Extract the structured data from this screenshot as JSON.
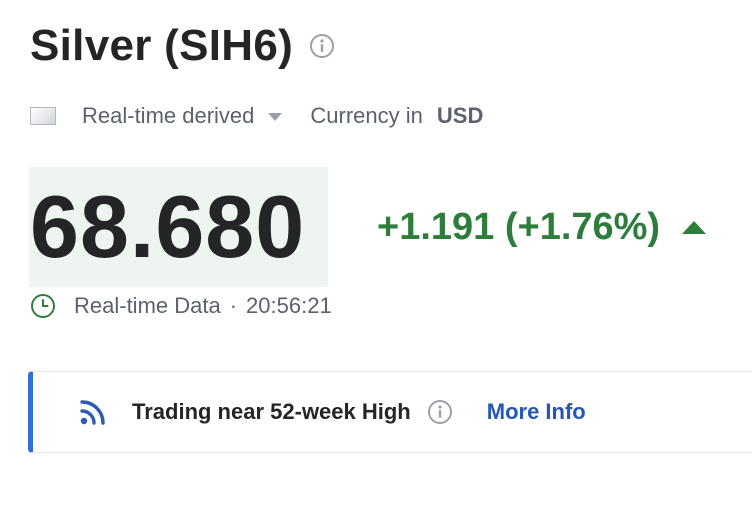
{
  "header": {
    "title": "Silver (SIH6)",
    "info_icon": "info-circle-icon"
  },
  "meta": {
    "flag_icon": "flag-icon",
    "data_type": "Real-time derived",
    "currency_label": "Currency in",
    "currency_code": "USD"
  },
  "quote": {
    "price": "68.680",
    "change": "+1.191 (+1.76%)",
    "direction": "up",
    "positive_color": "#2f7d3d",
    "highlight_color": "#eef5f0"
  },
  "status": {
    "clock_icon": "clock-icon",
    "label": "Real-time Data",
    "separator": "·",
    "time": "20:56:21"
  },
  "alert": {
    "icon": "signal-icon",
    "text": "Trading near 52-week High",
    "info_icon": "info-circle-icon",
    "link": "More Info",
    "accent_color": "#2f6fd8"
  }
}
